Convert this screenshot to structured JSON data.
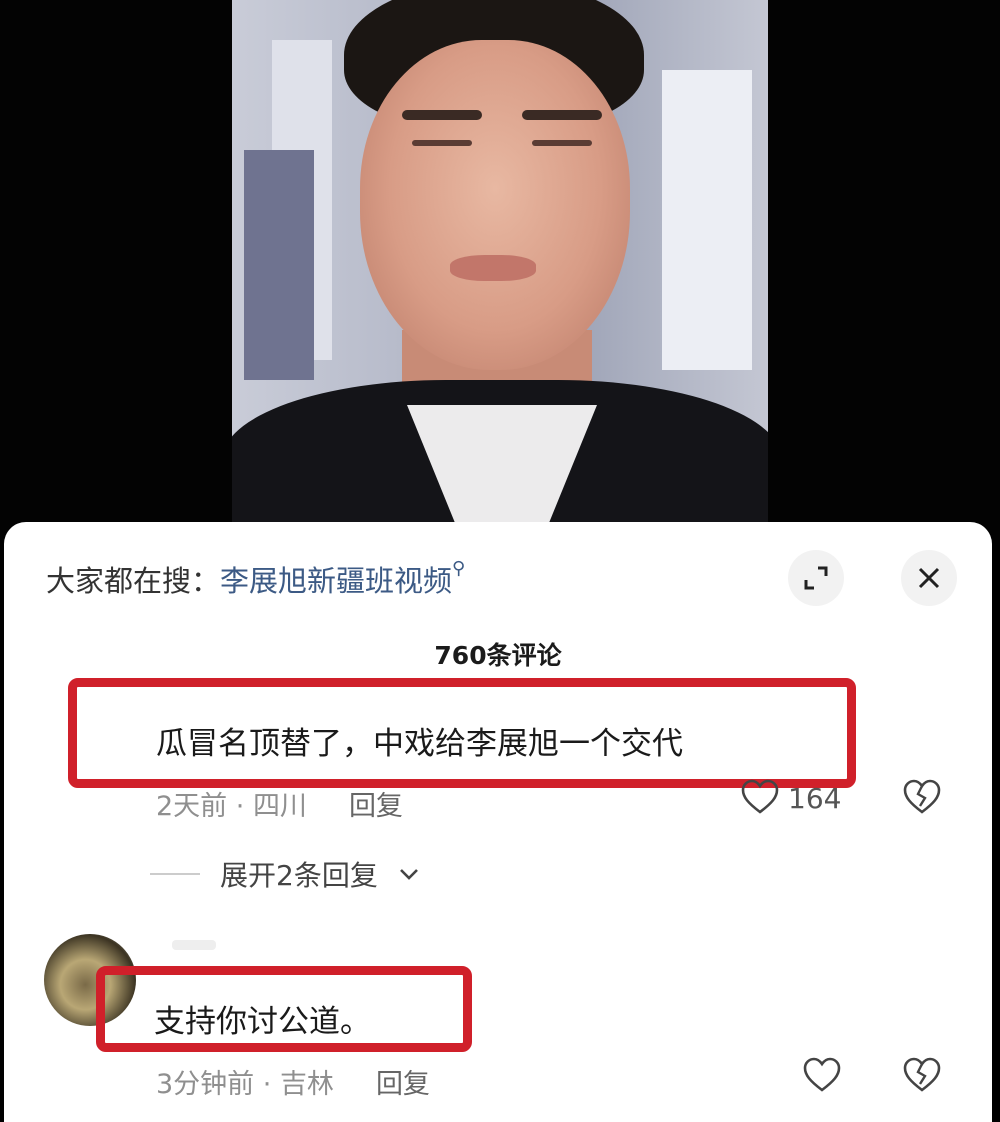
{
  "search": {
    "prefix": "大家都在搜：",
    "term": "李展旭新疆班视频"
  },
  "comment_count": "760条评论",
  "comments": [
    {
      "text": "瓜冒名顶替了，中戏给李展旭一个交代",
      "time": "2天前",
      "location": "四川",
      "reply_label": "回复",
      "likes": "164",
      "expand_replies": "展开2条回复"
    },
    {
      "text": "支持你讨公道。",
      "time": "3分钟前",
      "location": "吉林",
      "reply_label": "回复",
      "likes": ""
    }
  ],
  "colors": {
    "highlight_box": "#d0202a",
    "search_term": "#3c5a85"
  },
  "icons": [
    "search-icon",
    "expand-icon",
    "close-icon",
    "heart-icon",
    "broken-heart-icon",
    "chevron-down-icon"
  ]
}
